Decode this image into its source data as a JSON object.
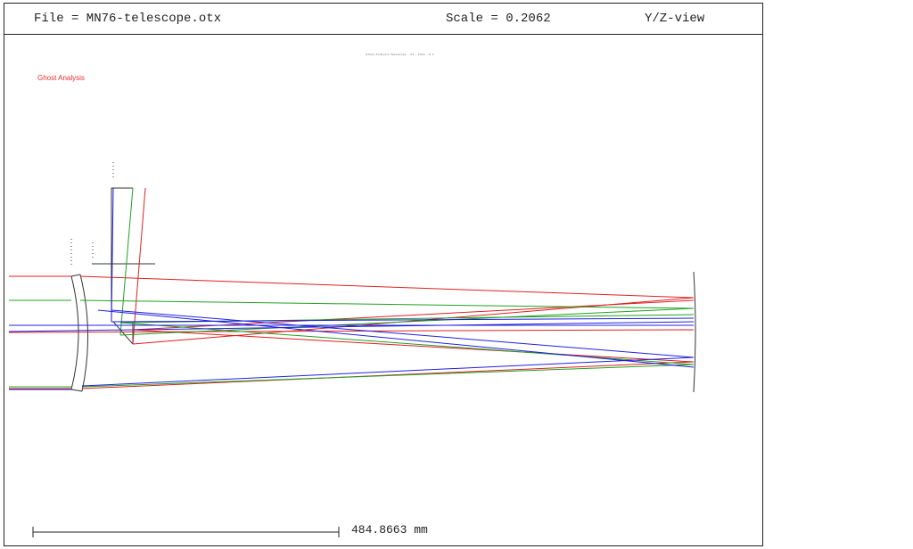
{
  "header": {
    "file_label": "File = MN76-telescope.otx",
    "scale_label": "Scale = 0.2062",
    "view_label": "Y/Z-view"
  },
  "diagram": {
    "title": "Ghost Analysis",
    "tiny_caption": "Ghost Analysis Telescope - 21 - 2011 - 0 1",
    "scale_bar_label": "484.8663 mm",
    "ray_colors": {
      "red": "#e02020",
      "green": "#20a020",
      "blue": "#2020e0",
      "optics": "#333333"
    }
  }
}
